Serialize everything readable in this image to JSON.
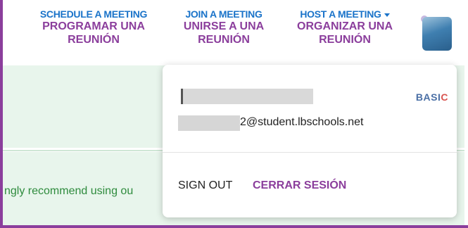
{
  "colors": {
    "frame_border": "#8b3e9c",
    "nav_english": "#1a73c9",
    "nav_spanish": "#8b3e9c",
    "panel_green": "#e8f5ec",
    "recommend_text": "#2e8b3d"
  },
  "nav": {
    "schedule": {
      "label": "SCHEDULE A MEETING",
      "translation": "PROGRAMAR UNA REUNIÓN"
    },
    "join": {
      "label": "JOIN A MEETING",
      "translation": "UNIRSE A UNA REUNIÓN"
    },
    "host": {
      "label": "HOST A MEETING",
      "translation": "ORGANIZAR UNA REUNIÓN",
      "icon": "caret-down-icon"
    }
  },
  "background": {
    "recommend_text": "ngly recommend using ou"
  },
  "account_menu": {
    "email": "2@student.lbschools.net",
    "plan": "BASI",
    "plan_last_letter": "C",
    "sign_out_label": "SIGN OUT",
    "sign_out_translation": "CERRAR SESIÓN"
  }
}
